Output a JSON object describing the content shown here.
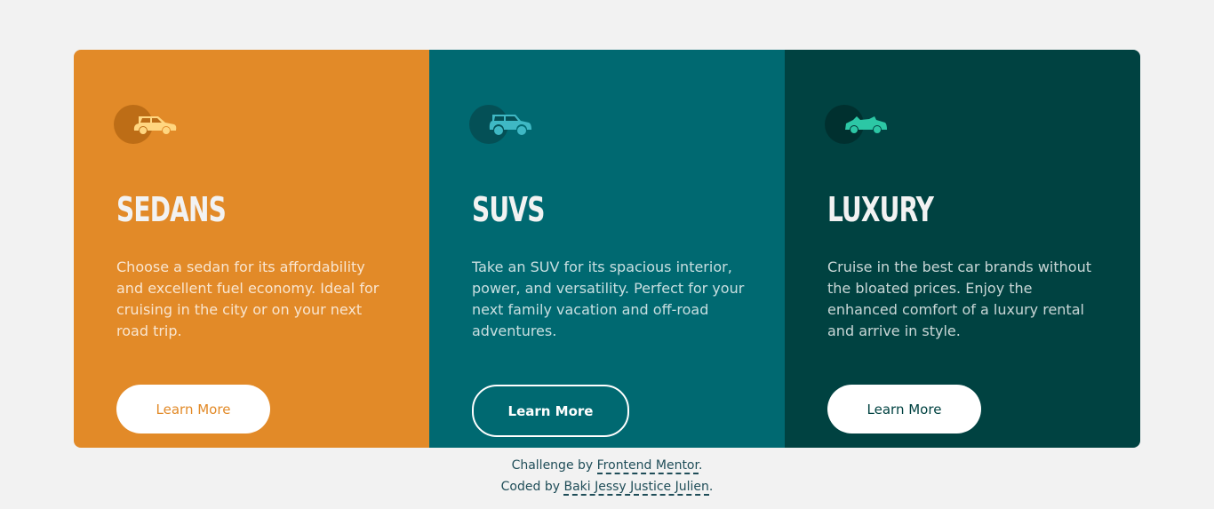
{
  "colors": {
    "background": "#f2f2f2",
    "sedans": "#e28a28",
    "suvs": "#006971",
    "luxury": "#004241"
  },
  "cards": [
    {
      "icon": "sedan-car-icon",
      "title": "Sedans",
      "description": "Choose a sedan for its affordability and excellent fuel economy. Ideal for cruising in the city or on your next road trip.",
      "button": "Learn More"
    },
    {
      "icon": "suv-car-icon",
      "title": "SUVs",
      "description": "Take an SUV for its spacious interior, power, and versatility. Perfect for your next family vacation and off-road adventures.",
      "button": "Learn More"
    },
    {
      "icon": "luxury-car-icon",
      "title": "Luxury",
      "description": "Cruise in the best car brands without the bloated prices. Enjoy the enhanced comfort of a luxury rental and arrive in style.",
      "button": "Learn More"
    }
  ],
  "footer": {
    "challenge_prefix": "Challenge by ",
    "challenge_link": "Frontend Mentor",
    "coded_prefix": "Coded by ",
    "coded_link": "Baki Jessy Justice Julien",
    "period": "."
  }
}
